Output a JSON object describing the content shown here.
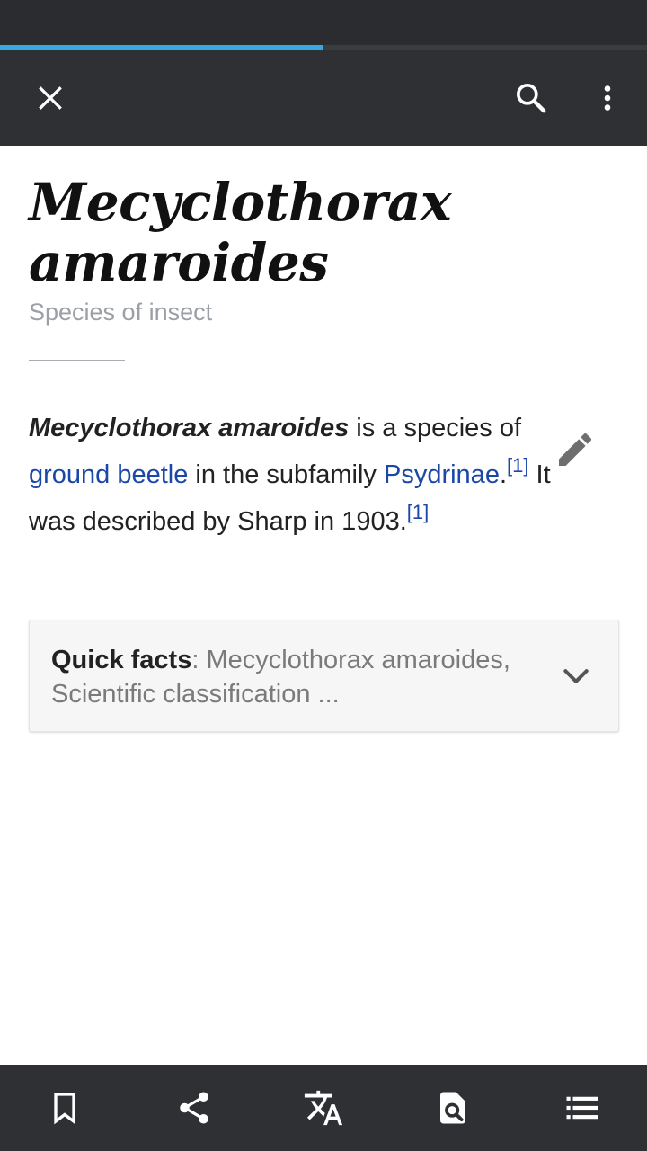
{
  "page_load_progress": 0.5,
  "toolbar": {
    "close_icon": "close-icon",
    "search_icon": "search-icon",
    "more_icon": "more-vert-icon"
  },
  "article": {
    "title": "Mecyclothorax amaroides",
    "description": "Species of insect",
    "lead": {
      "bold_name": "Mecyclothorax amaroides",
      "text_1": " is a species of ",
      "link_1": "ground beetle",
      "text_2": " in the subfamily ",
      "link_2": "Psydrinae",
      "text_3": ".",
      "ref_1": "[1]",
      "text_4": " It was described by Sharp in 1903.",
      "ref_2": "[1]"
    },
    "edit_icon": "pencil-icon"
  },
  "quick_facts": {
    "label": "Quick facts",
    "separator": ": ",
    "summary": "Mecyclothorax amaroides, Scientific classification ...",
    "chevron_icon": "chevron-down-icon"
  },
  "bottom_bar": {
    "icons": [
      "bookmark-icon",
      "share-icon",
      "translate-icon",
      "find-in-page-icon",
      "table-of-contents-icon"
    ]
  },
  "colors": {
    "bars": "#2f3033",
    "status_bar": "#2b2c2f",
    "progress": "#36a9e1",
    "link": "#1a47a8",
    "subtitle": "#9aa0a6"
  }
}
